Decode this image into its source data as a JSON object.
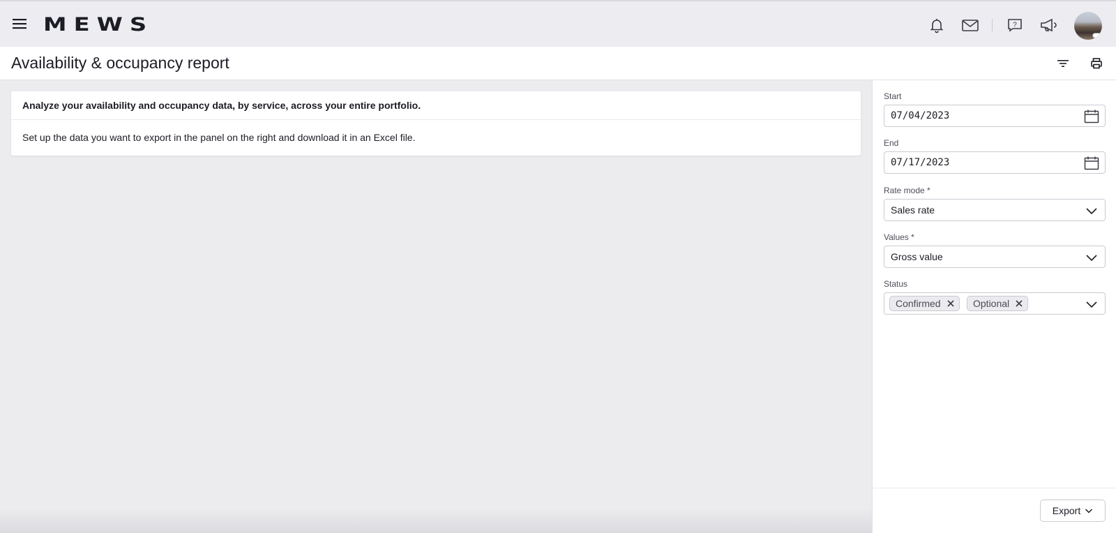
{
  "app": {
    "logo_text": "MEWS"
  },
  "topbar": {
    "icons": [
      "menu-icon",
      "bell-icon",
      "mail-icon",
      "help-icon",
      "megaphone-icon",
      "avatar"
    ]
  },
  "page": {
    "title": "Availability & occupancy report"
  },
  "header_actions": [
    "filter-icon",
    "print-icon"
  ],
  "info_card": {
    "headline": "Analyze your availability and occupancy data, by service, across your entire portfolio.",
    "description": "Set up the data you want to export in the panel on the right and download it in an Excel file."
  },
  "panel": {
    "start": {
      "label": "Start",
      "value": "07/04/2023"
    },
    "end": {
      "label": "End",
      "value": "07/17/2023"
    },
    "rate_mode": {
      "label": "Rate mode *",
      "value": "Sales rate"
    },
    "values": {
      "label": "Values *",
      "value": "Gross value"
    },
    "status": {
      "label": "Status",
      "chips": [
        "Confirmed",
        "Optional"
      ]
    },
    "export_label": "Export"
  },
  "colors": {
    "topbar_bg": "#ececf1",
    "page_bg": "#ececef",
    "text": "#1c1d24",
    "chip_bg": "#ebebef"
  }
}
